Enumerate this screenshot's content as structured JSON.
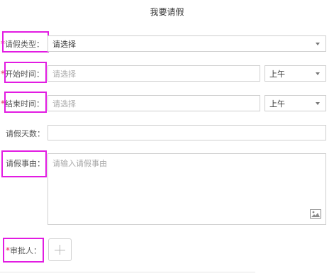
{
  "header": {
    "title": "我要请假"
  },
  "form": {
    "leave_type": {
      "required_mark": "*",
      "label": "请假类型：",
      "value": "请选择"
    },
    "start_time": {
      "required_mark": "*",
      "label": "开始时间：",
      "placeholder": "请选择",
      "period": "上午"
    },
    "end_time": {
      "required_mark": "*",
      "label": "结束时间：",
      "placeholder": "请选择",
      "period": "上午"
    },
    "days": {
      "label": "请假天数：",
      "value": ""
    },
    "reason": {
      "label": "请假事由：",
      "placeholder": "请输入请假事由"
    },
    "approver": {
      "required_mark": "*",
      "label": "审批人："
    }
  },
  "icons": {
    "select_caret": "chevron-down-icon",
    "add": "plus-icon",
    "image": "image-icon"
  },
  "colors": {
    "highlight": "#e21ce2",
    "required": "#e0245e"
  }
}
